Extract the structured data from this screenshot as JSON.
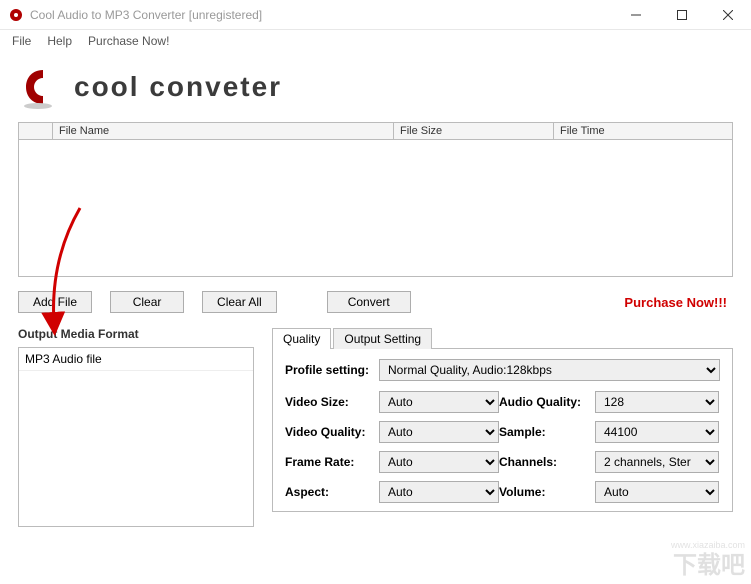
{
  "window": {
    "title": "Cool Audio to MP3 Converter  [unregistered]"
  },
  "menu": {
    "file": "File",
    "help": "Help",
    "purchase": "Purchase Now!"
  },
  "logo": {
    "text": "cool conveter"
  },
  "file_table": {
    "cols": {
      "c0": "",
      "c1": "File Name",
      "c2": "File Size",
      "c3": "File Time"
    },
    "rows": []
  },
  "buttons": {
    "add_file": "Add File",
    "clear": "Clear",
    "clear_all": "Clear All",
    "convert": "Convert"
  },
  "purchase_link": "Purchase Now!!!",
  "output": {
    "title": "Output Media Format",
    "items": [
      "MP3 Audio file"
    ]
  },
  "tabs": {
    "quality": "Quality",
    "output_setting": "Output Setting"
  },
  "profile": {
    "label": "Profile setting:",
    "value": "Normal Quality, Audio:128kbps"
  },
  "settings": {
    "video_size": {
      "label": "Video Size:",
      "value": "Auto"
    },
    "video_quality": {
      "label": "Video Quality:",
      "value": "Auto"
    },
    "frame_rate": {
      "label": "Frame Rate:",
      "value": "Auto"
    },
    "aspect": {
      "label": "Aspect:",
      "value": "Auto"
    },
    "audio_quality": {
      "label": "Audio Quality:",
      "value": "128"
    },
    "sample": {
      "label": "Sample:",
      "value": "44100"
    },
    "channels": {
      "label": "Channels:",
      "value": "2 channels, Ster"
    },
    "volume": {
      "label": "Volume:",
      "value": "Auto"
    }
  },
  "watermark": {
    "main": "下载吧",
    "sub": "www.xiazaiba.com"
  }
}
